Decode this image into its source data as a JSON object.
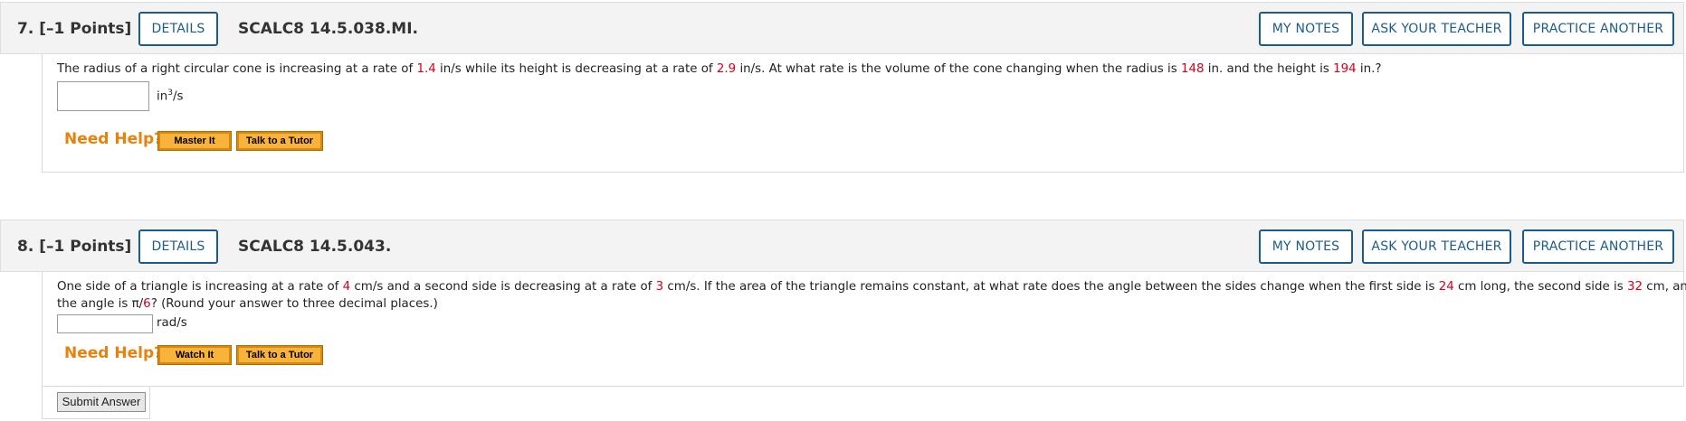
{
  "questions": [
    {
      "number_label": "7.",
      "points_label": "[–1 Points]",
      "details_label": "DETAILS",
      "code": "SCALC8 14.5.038.MI.",
      "my_notes_label": "MY NOTES",
      "ask_teacher_label": "ASK YOUR TEACHER",
      "practice_label": "PRACTICE ANOTHER",
      "text": {
        "p1": "The radius of a right circular cone is increasing at a rate of ",
        "v1": "1.4",
        "p2": " in/s while its height is decreasing at a rate of ",
        "v2": "2.9",
        "p3": " in/s. At what rate is the volume of the cone changing when the radius is ",
        "v3": "148",
        "p4": " in. and the height is ",
        "v4": "194",
        "p5": " in.?"
      },
      "answer_value": "",
      "unit_base": "in",
      "unit_exp": "3",
      "unit_tail": "/s",
      "need_help_label": "Need Help?",
      "help_buttons": [
        "Master It",
        "Talk to a Tutor"
      ]
    },
    {
      "number_label": "8.",
      "points_label": "[–1 Points]",
      "details_label": "DETAILS",
      "code": "SCALC8 14.5.043.",
      "my_notes_label": "MY NOTES",
      "ask_teacher_label": "ASK YOUR TEACHER",
      "practice_label": "PRACTICE ANOTHER",
      "text": {
        "p1": "One side of a triangle is increasing at a rate of ",
        "v1": "4",
        "p2": " cm/s and a second side is decreasing at a rate of ",
        "v2": "3",
        "p3": " cm/s. If the area of the triangle remains constant, at what rate does the angle between the sides change when the first side is ",
        "v3": "24",
        "p4": " cm long, the second side is ",
        "v4": "32",
        "p5": " cm, and",
        "line2_a": "the angle is π/",
        "v5": "6",
        "line2_b": "? (Round your answer to three decimal places.)"
      },
      "answer_value": "",
      "unit": "rad/s",
      "need_help_label": "Need Help?",
      "help_buttons": [
        "Watch It",
        "Talk to a Tutor"
      ],
      "submit_label": "Submit Answer"
    }
  ]
}
